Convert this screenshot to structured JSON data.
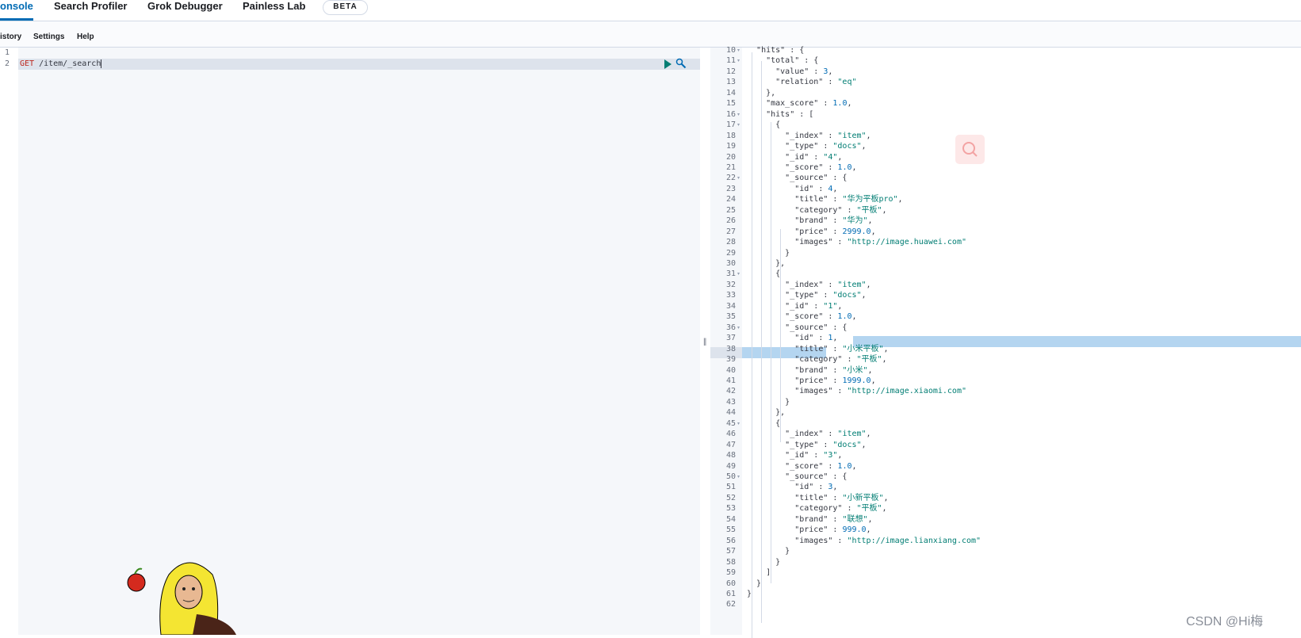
{
  "tabs": [
    {
      "label": "onsole"
    },
    {
      "label": "Search Profiler"
    },
    {
      "label": "Grok Debugger"
    },
    {
      "label": "Painless Lab"
    }
  ],
  "beta_badge": "BETA",
  "menu": [
    "istory",
    "Settings",
    "Help"
  ],
  "request": {
    "line_numbers": [
      "1",
      "2"
    ],
    "method": "GET",
    "path": " /item/_search"
  },
  "response": {
    "lines": [
      {
        "n": "10",
        "t": "  \"hits\" : {"
      },
      {
        "n": "11",
        "t": "    \"total\" : {"
      },
      {
        "n": "12",
        "t": "      \"value\" : 3,"
      },
      {
        "n": "13",
        "t": "      \"relation\" : \"eq\""
      },
      {
        "n": "14",
        "t": "    },"
      },
      {
        "n": "15",
        "t": "    \"max_score\" : 1.0,"
      },
      {
        "n": "16",
        "t": "    \"hits\" : ["
      },
      {
        "n": "17",
        "t": "      {"
      },
      {
        "n": "18",
        "t": "        \"_index\" : \"item\","
      },
      {
        "n": "19",
        "t": "        \"_type\" : \"docs\","
      },
      {
        "n": "20",
        "t": "        \"_id\" : \"4\","
      },
      {
        "n": "21",
        "t": "        \"_score\" : 1.0,"
      },
      {
        "n": "22",
        "t": "        \"_source\" : {"
      },
      {
        "n": "23",
        "t": "          \"id\" : 4,"
      },
      {
        "n": "24",
        "t": "          \"title\" : \"华为平板pro\","
      },
      {
        "n": "25",
        "t": "          \"category\" : \"平板\","
      },
      {
        "n": "26",
        "t": "          \"brand\" : \"华为\","
      },
      {
        "n": "27",
        "t": "          \"price\" : 2999.0,"
      },
      {
        "n": "28",
        "t": "          \"images\" : \"http://image.huawei.com\""
      },
      {
        "n": "29",
        "t": "        }"
      },
      {
        "n": "30",
        "t": "      },"
      },
      {
        "n": "31",
        "t": "      {"
      },
      {
        "n": "32",
        "t": "        \"_index\" : \"item\","
      },
      {
        "n": "33",
        "t": "        \"_type\" : \"docs\","
      },
      {
        "n": "34",
        "t": "        \"_id\" : \"1\","
      },
      {
        "n": "35",
        "t": "        \"_score\" : 1.0,"
      },
      {
        "n": "36",
        "t": "        \"_source\" : {"
      },
      {
        "n": "37",
        "t": "          \"id\" : 1,"
      },
      {
        "n": "38",
        "t": "          \"title\" : \"小米平板\","
      },
      {
        "n": "39",
        "t": "          \"category\" : \"平板\","
      },
      {
        "n": "40",
        "t": "          \"brand\" : \"小米\","
      },
      {
        "n": "41",
        "t": "          \"price\" : 1999.0,"
      },
      {
        "n": "42",
        "t": "          \"images\" : \"http://image.xiaomi.com\""
      },
      {
        "n": "43",
        "t": "        }"
      },
      {
        "n": "44",
        "t": "      },"
      },
      {
        "n": "45",
        "t": "      {"
      },
      {
        "n": "46",
        "t": "        \"_index\" : \"item\","
      },
      {
        "n": "47",
        "t": "        \"_type\" : \"docs\","
      },
      {
        "n": "48",
        "t": "        \"_id\" : \"3\","
      },
      {
        "n": "49",
        "t": "        \"_score\" : 1.0,"
      },
      {
        "n": "50",
        "t": "        \"_source\" : {"
      },
      {
        "n": "51",
        "t": "          \"id\" : 3,"
      },
      {
        "n": "52",
        "t": "          \"title\" : \"小新平板\","
      },
      {
        "n": "53",
        "t": "          \"category\" : \"平板\","
      },
      {
        "n": "54",
        "t": "          \"brand\" : \"联想\","
      },
      {
        "n": "55",
        "t": "          \"price\" : 999.0,"
      },
      {
        "n": "56",
        "t": "          \"images\" : \"http://image.lianxiang.com\""
      },
      {
        "n": "57",
        "t": "        }"
      },
      {
        "n": "58",
        "t": "      }"
      },
      {
        "n": "59",
        "t": "    ]"
      },
      {
        "n": "60",
        "t": "  }"
      },
      {
        "n": "61",
        "t": "}"
      },
      {
        "n": "62",
        "t": ""
      }
    ]
  },
  "watermark": "CSDN @Hi梅",
  "icons": {
    "run": "play-icon",
    "wrench": "wrench-icon",
    "search": "search-icon"
  },
  "colors": {
    "accent": "#006bb4",
    "method": "#bd271e",
    "string": "#017d73",
    "number": "#006bb4"
  }
}
